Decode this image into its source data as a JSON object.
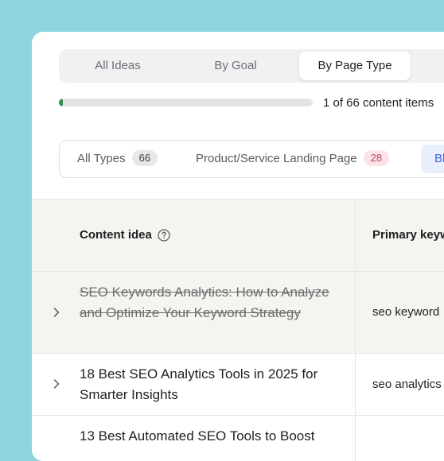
{
  "tabs": [
    {
      "label": "All Ideas",
      "active": false
    },
    {
      "label": "By Goal",
      "active": false
    },
    {
      "label": "By Page Type",
      "active": true
    }
  ],
  "progress": {
    "fraction": 0.015,
    "label": "1 of 66 content items"
  },
  "filters": {
    "all_types": {
      "label": "All Types",
      "count": "66"
    },
    "landing": {
      "label": "Product/Service Landing Page",
      "count": "28"
    },
    "active_label": "Bl"
  },
  "table": {
    "headers": {
      "content_idea": "Content idea",
      "primary_keyword": "Primary keyw"
    },
    "rows": [
      {
        "title": "SEO Keywords Analytics: How to Analyze and Optimize Your Keyword Strategy",
        "keyword": "seo keyword",
        "completed": true
      },
      {
        "title": "18 Best SEO Analytics Tools in 2025 for Smarter Insights",
        "keyword": "seo analytics",
        "completed": false
      },
      {
        "title": "13 Best Automated SEO Tools to Boost",
        "keyword": "",
        "completed": false
      }
    ]
  },
  "colors": {
    "accent_green": "#3a8d52",
    "accent_blue": "#3b64d8",
    "background": "#8fd5dd"
  }
}
